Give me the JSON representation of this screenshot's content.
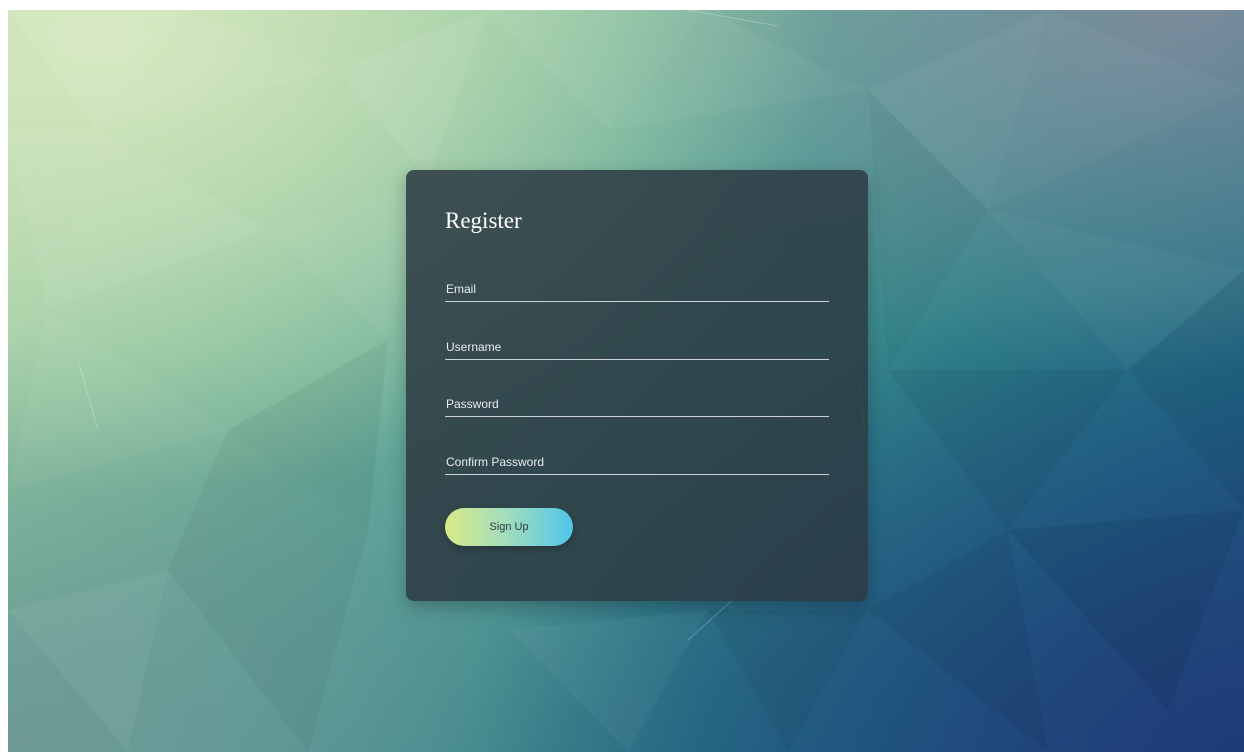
{
  "form": {
    "title": "Register",
    "fields": [
      {
        "name": "email",
        "placeholder": "Email",
        "value": ""
      },
      {
        "name": "username",
        "placeholder": "Username",
        "value": ""
      },
      {
        "name": "password",
        "placeholder": "Password",
        "value": ""
      },
      {
        "name": "confirm_password",
        "placeholder": "Confirm Password",
        "value": ""
      }
    ],
    "submit_label": "Sign Up"
  },
  "colors": {
    "card_background": "#2c3a42",
    "button_gradient_start": "#d9ea86",
    "button_gradient_end": "#4fc6e8",
    "text": "#ffffff"
  }
}
